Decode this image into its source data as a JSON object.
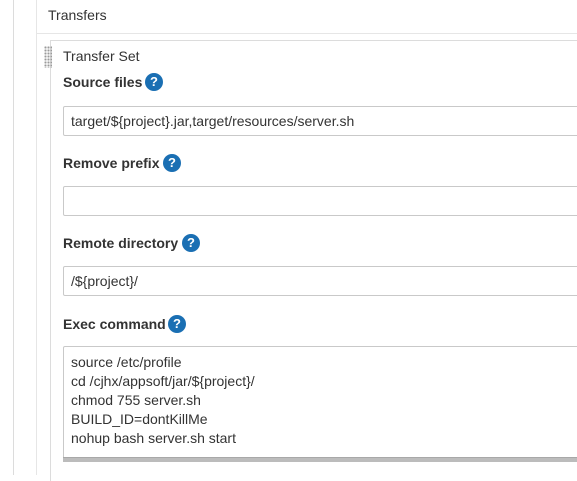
{
  "section": {
    "title": "Transfers"
  },
  "transfer_set": {
    "title": "Transfer Set",
    "help_glyph": "?",
    "source_files": {
      "label": "Source files",
      "value": "target/${project}.jar,target/resources/server.sh"
    },
    "remove_prefix": {
      "label": "Remove prefix",
      "value": ""
    },
    "remote_directory": {
      "label": "Remote directory",
      "value": "/${project}/"
    },
    "exec_command": {
      "label": "Exec command",
      "lines": [
        "source /etc/profile",
        "cd /cjhx/appsoft/jar/${project}/",
        "chmod 755 server.sh",
        "BUILD_ID=dontKillMe",
        "nohup bash server.sh start"
      ]
    }
  },
  "colors": {
    "help_icon": "#1a6fb3",
    "border": "#c9c9c9",
    "text": "#333333"
  }
}
